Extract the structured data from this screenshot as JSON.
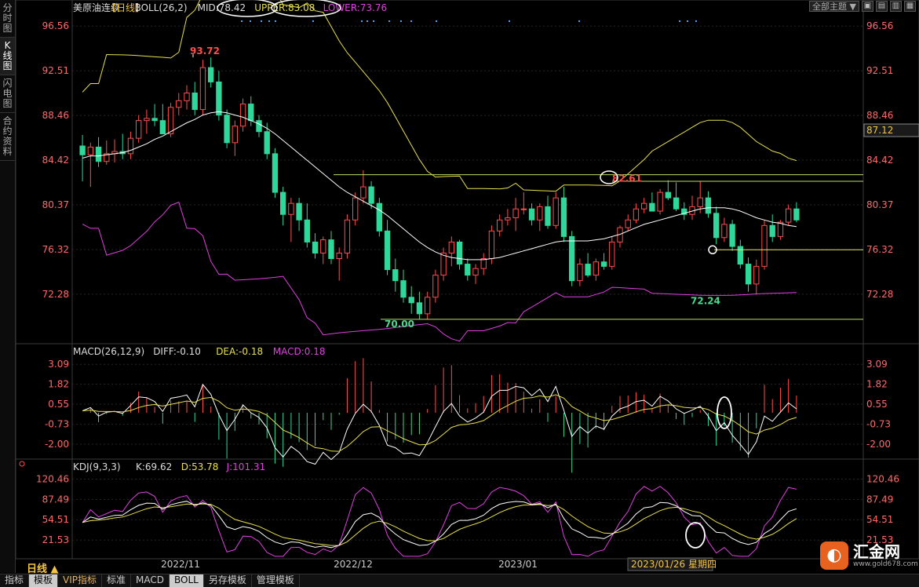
{
  "sidebar": {
    "tabs": [
      {
        "label": "分时图",
        "active": false
      },
      {
        "label": "K线图",
        "active": true
      },
      {
        "label": "闪电图",
        "active": false
      },
      {
        "label": "合约资料",
        "active": false
      }
    ]
  },
  "toolbar": {
    "theme_select": "全部主题",
    "theme_arrow": "▼",
    "buttons": [
      "▣",
      "▤",
      "▥",
      "▦"
    ]
  },
  "main_panel": {
    "legend": [
      {
        "text": "美原油连续",
        "color": "#dddddd"
      },
      {
        "text": "【日线】",
        "color": "#f5c542"
      },
      {
        "text": "BOLL(26,2)",
        "color": "#dddddd"
      },
      {
        "text": "MID:78.42",
        "color": "#dddddd"
      },
      {
        "text": "UPPER:83.08",
        "color": "#e8e04a"
      },
      {
        "text": "LOWER:73.76",
        "color": "#e040e0"
      }
    ],
    "y_ticks": [
      "96.56",
      "92.51",
      "88.46",
      "84.42",
      "80.37",
      "76.32",
      "72.28"
    ],
    "current_price_tag": "87.12",
    "annotations": [
      {
        "text": "93.72",
        "color": "#ff4d4d"
      },
      {
        "text": "82.61",
        "color": "#ff4d4d"
      },
      {
        "text": "70.00",
        "color": "#4fd68f"
      },
      {
        "text": "72.24",
        "color": "#4fd68f"
      }
    ]
  },
  "macd_panel": {
    "legend": [
      {
        "text": "MACD(26,12,9)",
        "color": "#dddddd"
      },
      {
        "text": "DIFF:-0.10",
        "color": "#dddddd"
      },
      {
        "text": "DEA:-0.18",
        "color": "#e8e04a"
      },
      {
        "text": "MACD:0.18",
        "color": "#e040e0"
      }
    ],
    "y_ticks": [
      "3.09",
      "1.82",
      "0.55",
      "-0.73",
      "-2.00"
    ]
  },
  "kdj_panel": {
    "legend": [
      {
        "text": "KDJ(9,3,3)",
        "color": "#dddddd"
      },
      {
        "text": "K:69.62",
        "color": "#dddddd"
      },
      {
        "text": "D:53.78",
        "color": "#e8e04a"
      },
      {
        "text": "J:101.31",
        "color": "#e040e0"
      }
    ],
    "y_ticks": [
      "120.46",
      "87.49",
      "54.51",
      "21.53"
    ]
  },
  "x_axis": {
    "labels": [
      "2022/11",
      "2022/12",
      "2023/01"
    ],
    "cursor_label": "2023/01/26 星期四"
  },
  "period_button": "日线 ▲",
  "bottom_tabs": [
    {
      "label": "指标",
      "active": false,
      "vip": false
    },
    {
      "label": "模板",
      "active": true,
      "vip": false
    },
    {
      "label": "VIP指标",
      "active": false,
      "vip": true
    },
    {
      "label": "标准",
      "active": false,
      "vip": false
    },
    {
      "label": "MACD",
      "active": false,
      "vip": false
    },
    {
      "label": "BOLL",
      "active": true,
      "vip": false
    },
    {
      "label": "另存模板",
      "active": false,
      "vip": false
    },
    {
      "label": "管理模板",
      "active": false,
      "vip": false
    }
  ],
  "logo": {
    "mark": "◐",
    "name": "汇金网",
    "site": "www.gold678.com"
  },
  "colors": {
    "up": "#ff4d4d",
    "down": "#2fd89a",
    "mid": "#ffffff",
    "upper": "#e8e04a",
    "lower": "#e040e0",
    "grid": "#333333",
    "hline": "#b8e060"
  },
  "chart_data": {
    "type": "candlestick",
    "title": "美原油连续【日线】",
    "ylim": [
      68.5,
      97.5
    ],
    "candles": [
      [
        85.7,
        86.7,
        82.5,
        84.9
      ],
      [
        84.9,
        86.0,
        82.0,
        85.6
      ],
      [
        85.6,
        86.5,
        83.8,
        84.3
      ],
      [
        84.3,
        86.2,
        84.0,
        85.0
      ],
      [
        85.0,
        86.3,
        84.2,
        85.2
      ],
      [
        85.2,
        86.8,
        84.5,
        85.0
      ],
      [
        85.0,
        87.0,
        84.5,
        86.4
      ],
      [
        86.4,
        88.5,
        86.0,
        88.0
      ],
      [
        88.0,
        89.0,
        86.8,
        88.2
      ],
      [
        88.2,
        89.5,
        87.5,
        88.0
      ],
      [
        88.0,
        89.5,
        86.8,
        86.8
      ],
      [
        86.8,
        89.6,
        86.5,
        89.2
      ],
      [
        89.2,
        90.5,
        88.5,
        89.8
      ],
      [
        89.8,
        91.2,
        89.0,
        90.5
      ],
      [
        90.5,
        91.5,
        88.5,
        89.0
      ],
      [
        89.0,
        93.5,
        88.5,
        92.8
      ],
      [
        92.8,
        93.72,
        91.0,
        91.5
      ],
      [
        91.5,
        92.5,
        88.0,
        88.5
      ],
      [
        88.5,
        89.0,
        85.5,
        86.0
      ],
      [
        86.0,
        88.0,
        84.8,
        87.5
      ],
      [
        87.5,
        90.0,
        87.0,
        89.5
      ],
      [
        89.5,
        90.2,
        87.5,
        88.0
      ],
      [
        88.0,
        88.5,
        86.5,
        87.0
      ],
      [
        87.0,
        87.8,
        84.5,
        85.0
      ],
      [
        85.0,
        85.5,
        81.0,
        81.5
      ],
      [
        81.5,
        82.0,
        78.5,
        79.5
      ],
      [
        79.5,
        81.0,
        77.0,
        80.5
      ],
      [
        80.5,
        81.0,
        78.0,
        79.0
      ],
      [
        79.0,
        80.5,
        76.5,
        77.0
      ],
      [
        77.0,
        77.8,
        75.5,
        76.0
      ],
      [
        76.0,
        77.5,
        75.0,
        77.2
      ],
      [
        77.2,
        78.0,
        75.0,
        75.5
      ],
      [
        75.5,
        76.5,
        73.5,
        76.0
      ],
      [
        76.0,
        79.5,
        75.5,
        79.0
      ],
      [
        79.0,
        81.5,
        78.5,
        81.0
      ],
      [
        81.0,
        83.5,
        80.5,
        82.0
      ],
      [
        82.0,
        82.5,
        80.0,
        80.5
      ],
      [
        80.5,
        81.0,
        77.5,
        78.0
      ],
      [
        78.0,
        79.0,
        74.0,
        74.5
      ],
      [
        74.5,
        75.5,
        72.5,
        73.5
      ],
      [
        73.5,
        74.5,
        71.5,
        72.0
      ],
      [
        72.0,
        73.0,
        70.5,
        71.5
      ],
      [
        71.5,
        72.5,
        70.0,
        70.5
      ],
      [
        70.5,
        72.5,
        70.0,
        72.0
      ],
      [
        72.0,
        74.5,
        71.5,
        74.0
      ],
      [
        74.0,
        76.5,
        73.5,
        76.0
      ],
      [
        76.0,
        77.5,
        74.8,
        77.0
      ],
      [
        77.0,
        77.2,
        74.5,
        75.0
      ],
      [
        75.0,
        75.5,
        73.5,
        74.0
      ],
      [
        74.0,
        75.0,
        73.2,
        74.6
      ],
      [
        74.6,
        76.0,
        74.0,
        75.5
      ],
      [
        75.5,
        78.5,
        75.0,
        78.0
      ],
      [
        78.0,
        79.5,
        77.5,
        79.0
      ],
      [
        79.0,
        80.0,
        78.5,
        79.2
      ],
      [
        79.2,
        81.0,
        78.0,
        80.0
      ],
      [
        80.0,
        81.5,
        79.5,
        80.0
      ],
      [
        80.0,
        80.5,
        78.5,
        79.0
      ],
      [
        79.0,
        80.5,
        78.0,
        80.2
      ],
      [
        80.2,
        81.2,
        78.2,
        78.5
      ],
      [
        78.5,
        81.5,
        78.2,
        81.0
      ],
      [
        81.0,
        82.0,
        77.0,
        77.5
      ],
      [
        77.5,
        78.0,
        73.0,
        73.5
      ],
      [
        73.5,
        75.5,
        73.0,
        75.0
      ],
      [
        75.0,
        76.0,
        73.8,
        74.0
      ],
      [
        74.0,
        75.5,
        73.5,
        75.2
      ],
      [
        75.2,
        76.0,
        74.5,
        74.8
      ],
      [
        74.8,
        77.5,
        74.5,
        77.0
      ],
      [
        77.0,
        78.5,
        76.5,
        78.3
      ],
      [
        78.3,
        79.5,
        78.0,
        79.0
      ],
      [
        79.0,
        80.5,
        78.7,
        80.0
      ],
      [
        80.0,
        81.0,
        79.6,
        80.5
      ],
      [
        80.5,
        81.5,
        80.0,
        79.8
      ],
      [
        79.8,
        81.8,
        79.5,
        81.5
      ],
      [
        81.5,
        82.6,
        80.8,
        81.0
      ],
      [
        81.0,
        82.4,
        79.8,
        80.0
      ],
      [
        80.0,
        80.6,
        79.0,
        79.5
      ],
      [
        79.5,
        81.2,
        79.0,
        80.2
      ],
      [
        80.2,
        82.5,
        79.6,
        81.0
      ],
      [
        81.0,
        81.6,
        79.2,
        79.6
      ],
      [
        79.6,
        80.2,
        76.8,
        77.4
      ],
      [
        77.4,
        79.2,
        77.0,
        78.6
      ],
      [
        78.6,
        79.0,
        76.2,
        76.6
      ],
      [
        76.6,
        77.2,
        74.6,
        75.0
      ],
      [
        75.0,
        75.6,
        72.5,
        73.2
      ],
      [
        73.2,
        75.4,
        72.24,
        74.8
      ],
      [
        74.8,
        79.0,
        74.5,
        78.5
      ],
      [
        78.5,
        79.5,
        77.0,
        77.5
      ],
      [
        77.5,
        79.0,
        77.2,
        78.8
      ],
      [
        78.8,
        80.4,
        78.5,
        80.0
      ],
      [
        80.0,
        80.6,
        78.8,
        79.0
      ]
    ],
    "mid": [
      84.6,
      84.8,
      84.8,
      84.9,
      85.0,
      85.1,
      85.3,
      85.6,
      85.9,
      86.3,
      86.6,
      87.0,
      87.4,
      87.8,
      88.1,
      88.5,
      88.7,
      88.8,
      88.7,
      88.5,
      88.3,
      88.0,
      87.7,
      87.3,
      86.8,
      86.2,
      85.6,
      85.0,
      84.4,
      83.8,
      83.2,
      82.6,
      82.0,
      81.5,
      81.1,
      80.7,
      80.3,
      79.9,
      79.4,
      78.8,
      78.2,
      77.6,
      77.0,
      76.5,
      76.1,
      75.8,
      75.6,
      75.5,
      75.4,
      75.4,
      75.4,
      75.5,
      75.6,
      75.8,
      76.0,
      76.2,
      76.4,
      76.6,
      76.8,
      77.0,
      77.1,
      77.1,
      77.1,
      77.1,
      77.2,
      77.3,
      77.5,
      77.7,
      78.0,
      78.3,
      78.6,
      78.8,
      79.0,
      79.2,
      79.4,
      79.6,
      79.8,
      80.0,
      80.1,
      80.1,
      80.1,
      80.0,
      79.8,
      79.5,
      79.2,
      79.0,
      78.8,
      78.7,
      78.5,
      78.4
    ]
  }
}
